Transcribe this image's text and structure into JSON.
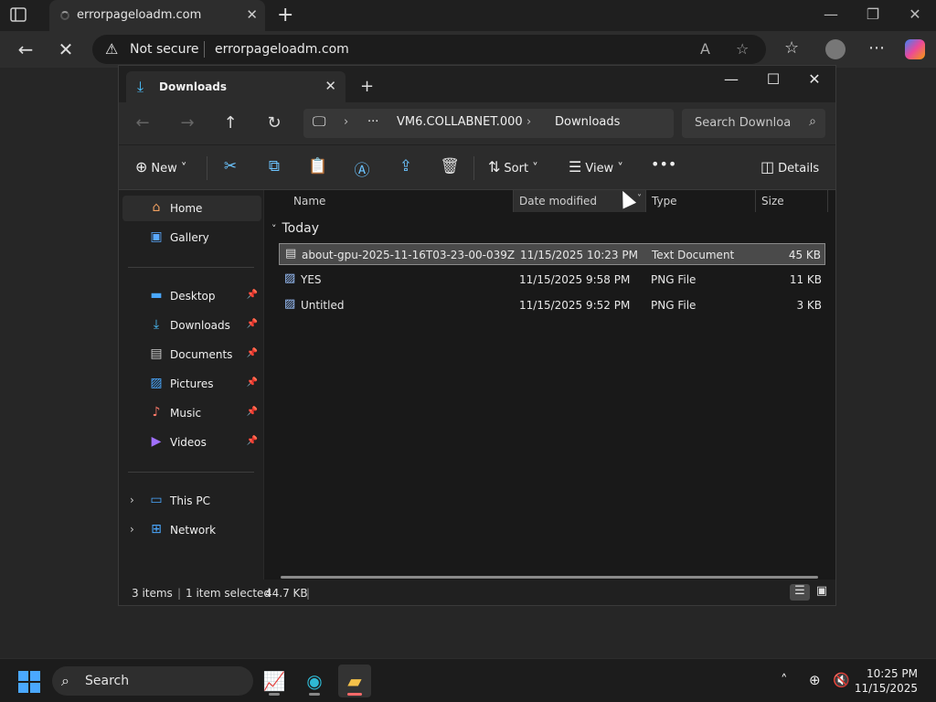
{
  "browser": {
    "tab_title": "errorpageloadm.com",
    "security_label": "Not secure",
    "url": "errorpageloadm.com"
  },
  "explorer": {
    "tab_label": "Downloads",
    "breadcrumb": {
      "overflow": "···",
      "path": [
        "VM6.COLLABNET.000",
        "Downloads"
      ]
    },
    "search_placeholder": "Search Downloads",
    "commands": {
      "new": "New",
      "sort": "Sort",
      "view": "View",
      "details": "Details"
    },
    "sidebar": {
      "top": [
        {
          "label": "Home",
          "icon": "home-icon",
          "active": true
        },
        {
          "label": "Gallery",
          "icon": "gallery-icon"
        }
      ],
      "pinned": [
        {
          "label": "Desktop",
          "icon": "desktop-icon"
        },
        {
          "label": "Downloads",
          "icon": "download-icon"
        },
        {
          "label": "Documents",
          "icon": "documents-icon"
        },
        {
          "label": "Pictures",
          "icon": "pictures-icon"
        },
        {
          "label": "Music",
          "icon": "music-icon"
        },
        {
          "label": "Videos",
          "icon": "videos-icon"
        }
      ],
      "bottom": [
        {
          "label": "This PC",
          "icon": "pc-icon"
        },
        {
          "label": "Network",
          "icon": "network-icon"
        }
      ]
    },
    "columns": {
      "name": "Name",
      "date": "Date modified",
      "type": "Type",
      "size": "Size"
    },
    "group": "Today",
    "files": [
      {
        "name": "about-gpu-2025-11-16T03-23-00-039Z",
        "date": "11/15/2025 10:23 PM",
        "type": "Text Document",
        "size": "45 KB",
        "selected": true
      },
      {
        "name": "YES",
        "date": "11/15/2025 9:58 PM",
        "type": "PNG File",
        "size": "11 KB"
      },
      {
        "name": "Untitled",
        "date": "11/15/2025 9:52 PM",
        "type": "PNG File",
        "size": "3 KB"
      }
    ],
    "status": {
      "items": "3 items",
      "selected": "1 item selected",
      "size": "44.7 KB"
    }
  },
  "taskbar": {
    "search_label": "Search",
    "time": "10:25 PM",
    "date": "11/15/2025"
  }
}
